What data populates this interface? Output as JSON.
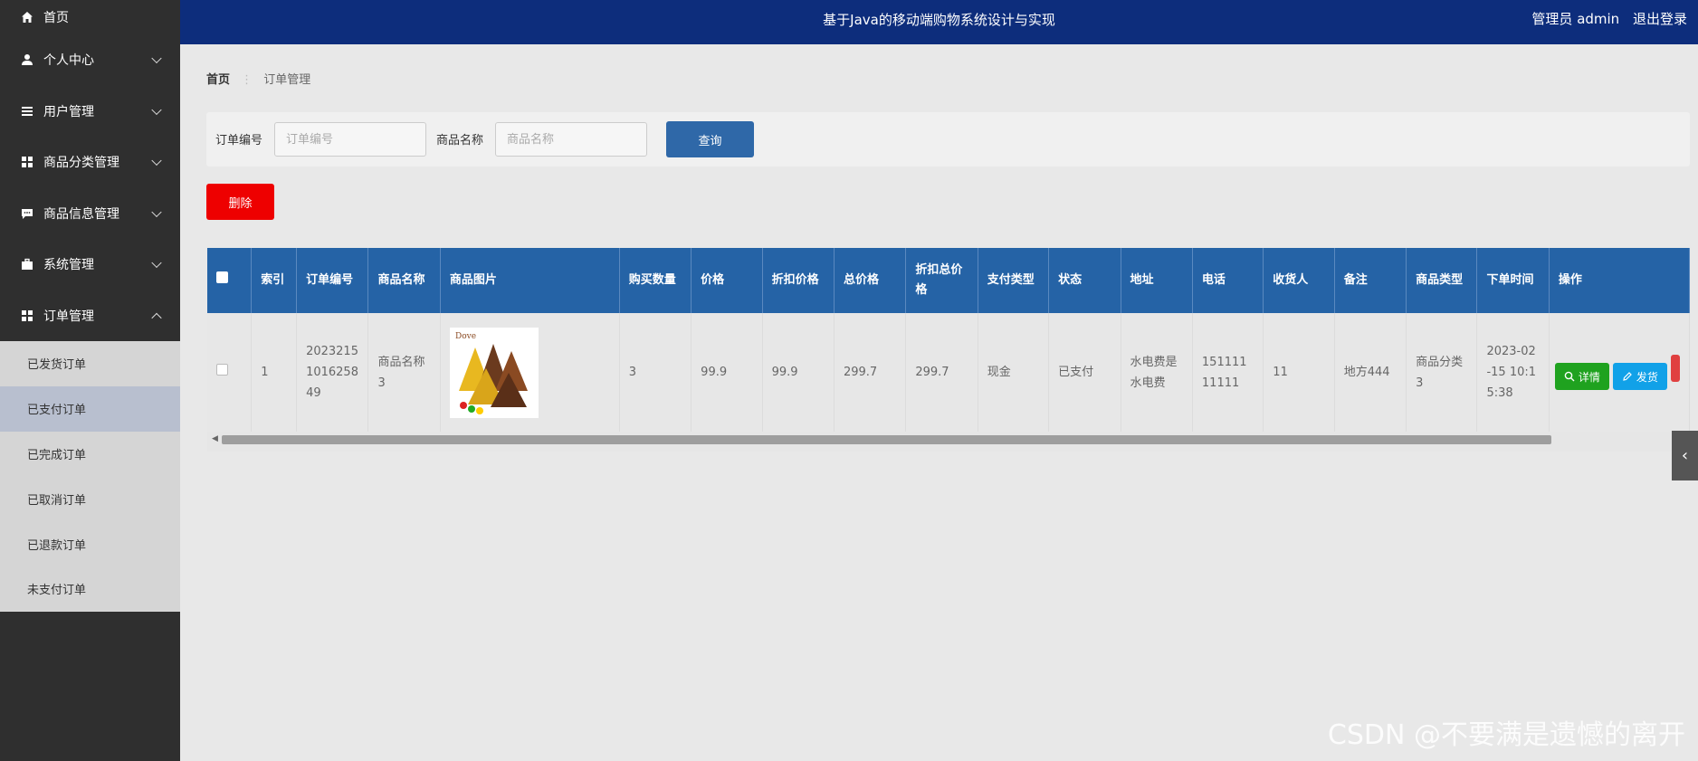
{
  "app": {
    "title": "基于Java的移动端购物系统设计与实现"
  },
  "header": {
    "user_label": "管理员 admin",
    "logout": "退出登录"
  },
  "sidebar": {
    "items": [
      {
        "label": "首页",
        "icon": "home-icon"
      },
      {
        "label": "个人中心",
        "icon": "person-icon"
      },
      {
        "label": "用户管理",
        "icon": "list-icon"
      },
      {
        "label": "商品分类管理",
        "icon": "grid-icon"
      },
      {
        "label": "商品信息管理",
        "icon": "chat-icon"
      },
      {
        "label": "系统管理",
        "icon": "briefcase-icon"
      },
      {
        "label": "订单管理",
        "icon": "grid-icon"
      }
    ],
    "subitems": [
      "已发货订单",
      "已支付订单",
      "已完成订单",
      "已取消订单",
      "已退款订单",
      "未支付订单"
    ],
    "active_sub": "已支付订单"
  },
  "breadcrumb": {
    "home": "首页",
    "current": "订单管理"
  },
  "search": {
    "order_no_label": "订单编号",
    "order_no_placeholder": "订单编号",
    "product_name_label": "商品名称",
    "product_name_placeholder": "商品名称",
    "query_button": "查询"
  },
  "toolbar": {
    "delete_button": "删除"
  },
  "table": {
    "headers": [
      "索引",
      "订单编号",
      "商品名称",
      "商品图片",
      "购买数量",
      "价格",
      "折扣价格",
      "总价格",
      "折扣总价格",
      "支付类型",
      "状态",
      "地址",
      "电话",
      "收货人",
      "备注",
      "商品类型",
      "下单时间",
      "操作"
    ],
    "rows": [
      {
        "index": "1",
        "order_no": "20232151016258 49",
        "product_name": "商品名称3",
        "image_label": "Dove",
        "quantity": "3",
        "price": "99.9",
        "discount_price": "99.9",
        "total_price": "299.7",
        "discount_total": "299.7",
        "pay_type": "现金",
        "status": "已支付",
        "address": "水电费是水电费",
        "phone": "15111111111",
        "receiver": "11",
        "remark": "地方444",
        "category": "商品分类3",
        "order_time": "2023-02-15 10:15:38"
      }
    ],
    "actions": {
      "detail": "详情",
      "ship": "发货"
    }
  },
  "watermark": "CSDN @不要满是遗憾的离开",
  "colors": {
    "header_bg": "#0d2d7c",
    "sidebar_bg": "#2f2f2f",
    "table_head": "#2563a6",
    "query_btn": "#2f68a8",
    "delete_btn": "#ee0000",
    "detail_btn": "#1fa21f",
    "ship_btn": "#11a1e8"
  }
}
